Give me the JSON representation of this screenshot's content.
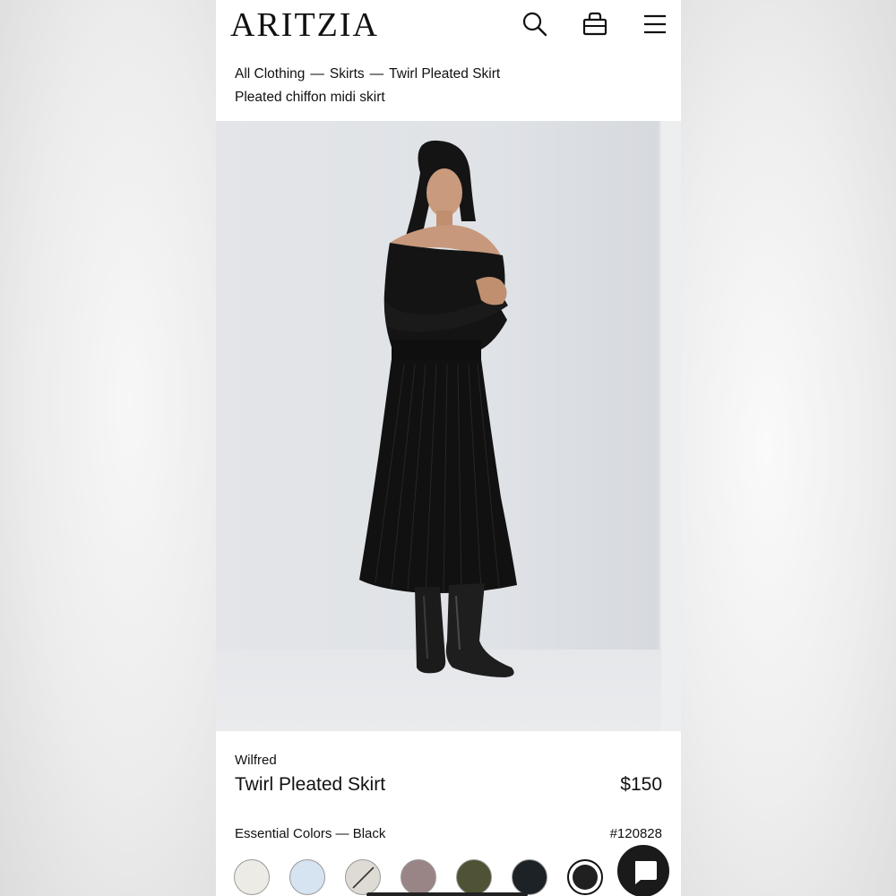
{
  "header": {
    "logo": "ARITZIA",
    "icons": [
      "search-icon",
      "bag-icon",
      "menu-icon"
    ]
  },
  "breadcrumb": {
    "items": [
      "All Clothing",
      "Skirts",
      "Twirl Pleated Skirt"
    ],
    "separator": "—"
  },
  "product": {
    "subtitle": "Pleated chiffon midi skirt",
    "brand": "Wilfred",
    "name": "Twirl Pleated Skirt",
    "price": "$150",
    "color_label": "Essential Colors — Black",
    "sku": "#120828"
  },
  "swatches": [
    {
      "name": "ivory",
      "color": "#ecebe6",
      "selected": false
    },
    {
      "name": "light-blue",
      "color": "#d6e3f1",
      "selected": false
    },
    {
      "name": "unavailable",
      "color": "#dedad4",
      "selected": false
    },
    {
      "name": "mauve",
      "color": "#9a8586",
      "selected": false
    },
    {
      "name": "olive",
      "color": "#4f5234",
      "selected": false
    },
    {
      "name": "navy",
      "color": "#1c2226",
      "selected": false
    },
    {
      "name": "black",
      "color": "#202020",
      "selected": true
    }
  ],
  "chat": {
    "icon": "chat-icon"
  }
}
